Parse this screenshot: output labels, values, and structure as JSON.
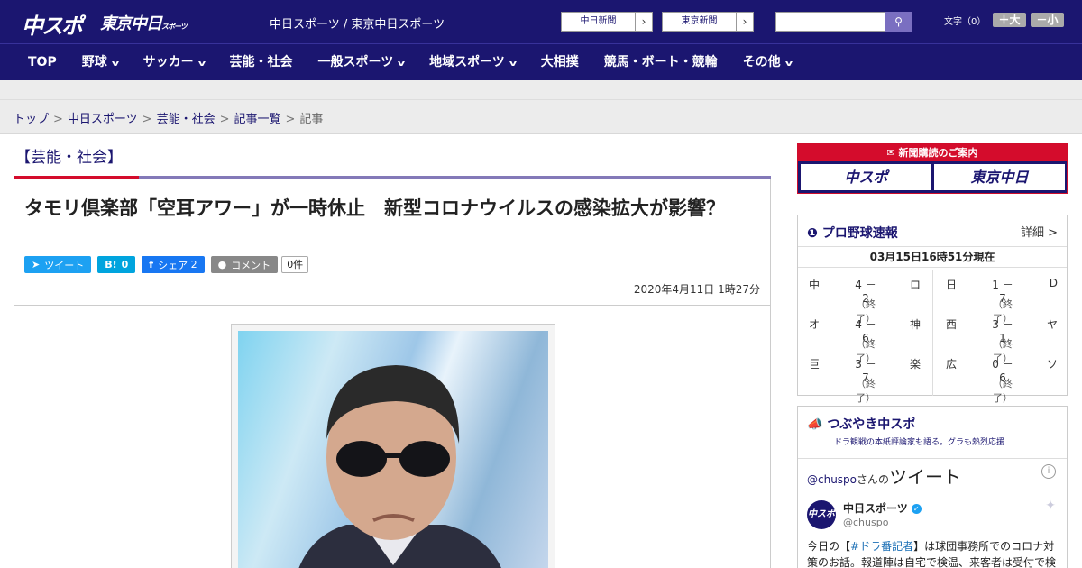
{
  "header": {
    "logo_main": "中スポ",
    "logo_tokyo": "東京中日",
    "logo_tokyo_small": "スポーツ",
    "tagline": "中日スポーツ / 東京中日スポーツ",
    "ext_links": [
      {
        "label": "中日新聞"
      },
      {
        "label": "東京新聞"
      }
    ],
    "search_placeholder": "",
    "font_size_label": "文字（0）",
    "font_bigger": "＋大",
    "font_smaller": "－小"
  },
  "nav": {
    "items": [
      {
        "label": "TOP",
        "dropdown": false
      },
      {
        "label": "野球",
        "dropdown": true
      },
      {
        "label": "サッカー",
        "dropdown": true
      },
      {
        "label": "芸能・社会",
        "dropdown": false
      },
      {
        "label": "一般スポーツ",
        "dropdown": true
      },
      {
        "label": "地域スポーツ",
        "dropdown": true
      },
      {
        "label": "大相撲",
        "dropdown": false
      },
      {
        "label": "競馬・ボート・競輪",
        "dropdown": false
      },
      {
        "label": "その他",
        "dropdown": true
      }
    ]
  },
  "breadcrumb": {
    "items": [
      "トップ",
      "中日スポーツ",
      "芸能・社会",
      "記事一覧"
    ],
    "current": "記事"
  },
  "section_title": "【芸能・社会】",
  "article": {
    "headline": "タモリ倶楽部「空耳アワー」が一時休止　新型コロナウイルスの感染拡大が影響？",
    "share": {
      "tweet": "ツイート",
      "hatena_icon": "B!",
      "hatena_count": "0",
      "facebook": "シェア",
      "facebook_count": "2",
      "comment": "コメント",
      "comment_count": "0件"
    },
    "date": "2020年4月11日 1時27分"
  },
  "sidebar": {
    "subscribe": {
      "heading": "新聞購読のご案内",
      "btn1": "中スポ",
      "btn2": "東京中日"
    },
    "baseball": {
      "title": "プロ野球速報",
      "more": "詳細 >",
      "updated": "03月15日16時51分現在",
      "games": [
        {
          "home": "中",
          "score": "4 － 2",
          "away": "ロ",
          "status": "（終了）"
        },
        {
          "home": "オ",
          "score": "4 － 6",
          "away": "神",
          "status": "（終了）"
        },
        {
          "home": "巨",
          "score": "3 － 7",
          "away": "楽",
          "status": "（終了）"
        },
        {
          "home": "日",
          "score": "1 － 7",
          "away": "D",
          "status": "（終了）"
        },
        {
          "home": "西",
          "score": "3 － 1",
          "away": "ヤ",
          "status": "（終了）"
        },
        {
          "home": "広",
          "score": "0 － 6",
          "away": "ソ",
          "status": "（終了）"
        }
      ]
    },
    "twitter": {
      "title": "つぶやき中スポ",
      "subtitle": "ドラ観戦の本紙評論家も語る。グラも熱烈応援",
      "handle_head": "@chuspo",
      "handle_suffix": "さんの",
      "tweets_label": "ツイート",
      "account_name": "中日スポーツ",
      "account_handle": "@chuspo",
      "avatar_text": "中スポ",
      "tweet_pre": "今日の【",
      "tweet_tag": "#ドラ番記者",
      "tweet_post": "】は球団事務所でのコロナ対策のお話。報道陣は自宅で検温、来客者は受付で検"
    }
  },
  "colors": {
    "brand": "#1b1670",
    "accent": "#d40c2c",
    "twitter": "#1da1f2",
    "facebook": "#3b5998",
    "hatena": "#00a4de"
  }
}
